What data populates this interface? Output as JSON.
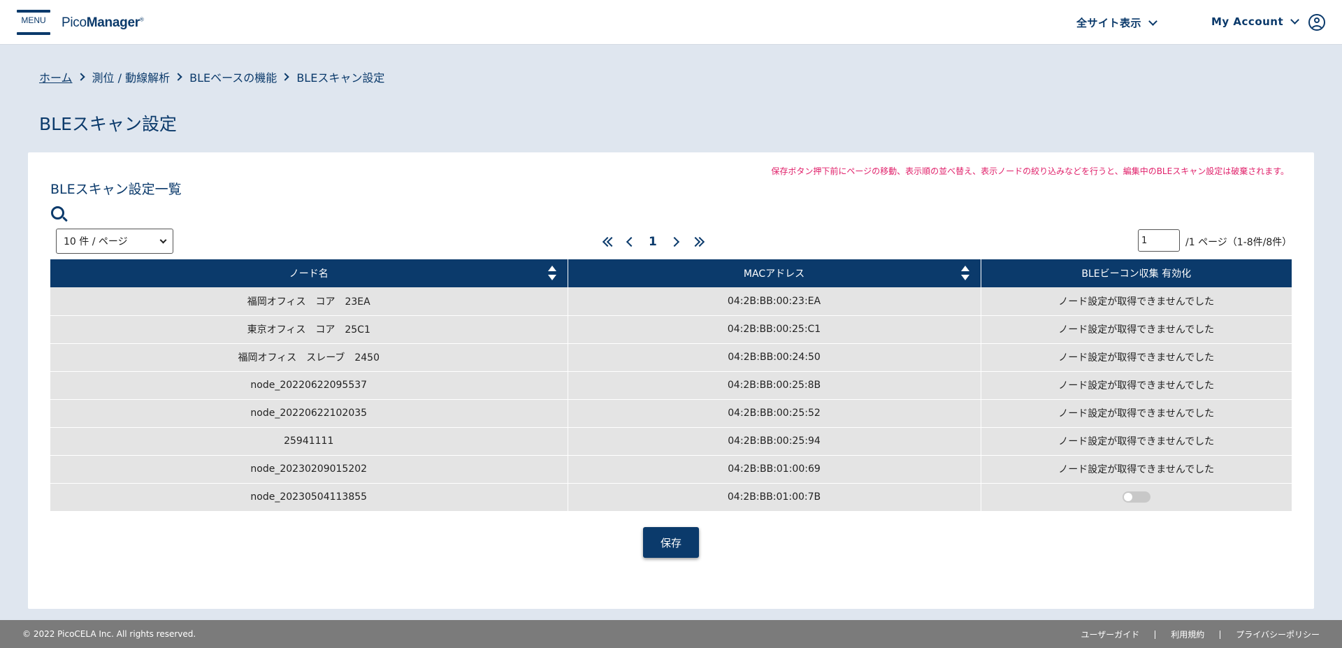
{
  "header": {
    "menu_label": "MENU",
    "logo_light": "Pico",
    "logo_bold": "Manager",
    "logo_mark": "®",
    "site_view": "全サイト表示",
    "my_account": "My Account"
  },
  "breadcrumb": {
    "items": [
      "ホーム",
      "測位 / 動線解析",
      "BLEベースの機能",
      "BLEスキャン設定"
    ]
  },
  "page_title": "BLEスキャン設定",
  "card": {
    "warning": "保存ボタン押下前にページの移動、表示順の並べ替え、表示ノードの絞り込みなどを行うと、編集中のBLEスキャン設定は破棄されます。",
    "title": "BLEスキャン設定一覧",
    "page_size": "10 件 / ページ",
    "current_page": "1",
    "page_input": "1",
    "page_info": "/1 ページ（1-8件/8件）"
  },
  "table": {
    "headers": [
      "ノード名",
      "MACアドレス",
      "BLEビーコン収集 有効化"
    ],
    "rows": [
      {
        "name": "福岡オフィス　コア　23EA",
        "mac": "04:2B:BB:00:23:EA",
        "status": "ノード設定が取得できませんでした"
      },
      {
        "name": "東京オフィス　コア　25C1",
        "mac": "04:2B:BB:00:25:C1",
        "status": "ノード設定が取得できませんでした"
      },
      {
        "name": "福岡オフィス　スレーブ　2450",
        "mac": "04:2B:BB:00:24:50",
        "status": "ノード設定が取得できませんでした"
      },
      {
        "name": "node_20220622095537",
        "mac": "04:2B:BB:00:25:8B",
        "status": "ノード設定が取得できませんでした"
      },
      {
        "name": "node_20220622102035",
        "mac": "04:2B:BB:00:25:52",
        "status": "ノード設定が取得できませんでした"
      },
      {
        "name": "25941111",
        "mac": "04:2B:BB:00:25:94",
        "status": "ノード設定が取得できませんでした"
      },
      {
        "name": "node_20230209015202",
        "mac": "04:2B:BB:01:00:69",
        "status": "ノード設定が取得できませんでした"
      },
      {
        "name": "node_20230504113855",
        "mac": "04:2B:BB:01:00:7B",
        "status": "",
        "toggle_on": false
      }
    ]
  },
  "save_label": "保存",
  "footer": {
    "copyright": "© 2022 PicoCELA Inc. All rights reserved.",
    "links": [
      "ユーザーガイド",
      "利用規約",
      "プライバシーポリシー"
    ]
  },
  "colors": {
    "primary": "#0b3a6b",
    "background": "#dfe6ef",
    "warning": "#e0206a",
    "footer": "#7b7b7b",
    "row": "#e4e4e4"
  }
}
